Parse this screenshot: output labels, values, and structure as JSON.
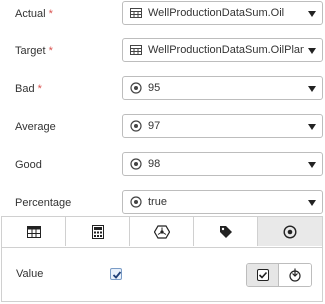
{
  "fields": [
    {
      "label": "Actual",
      "required": true,
      "icon": "table-icon",
      "value": "WellProductionDataSum.Oil"
    },
    {
      "label": "Target",
      "required": true,
      "icon": "table-icon",
      "value": "WellProductionDataSum.OilPlanr"
    },
    {
      "label": "Bad",
      "required": true,
      "icon": "constant-icon",
      "value": "95"
    },
    {
      "label": "Average",
      "required": false,
      "icon": "constant-icon",
      "value": "97"
    },
    {
      "label": "Good",
      "required": false,
      "icon": "constant-icon",
      "value": "98"
    },
    {
      "label": "Percentage",
      "required": false,
      "icon": "constant-icon",
      "value": "true"
    }
  ],
  "required_marker": "*",
  "panel": {
    "tabs": [
      {
        "icon": "table-icon",
        "active": false
      },
      {
        "icon": "calculator-icon",
        "active": false
      },
      {
        "icon": "network-icon",
        "active": false
      },
      {
        "icon": "tag-icon",
        "active": false
      },
      {
        "icon": "constant-icon",
        "active": true
      }
    ],
    "value_label": "Value",
    "checkbox_checked": true,
    "mode_buttons": [
      {
        "icon": "checkbox-mode-icon",
        "active": true
      },
      {
        "icon": "expression-mode-icon",
        "active": false
      }
    ]
  },
  "colors": {
    "required": "#d9534f",
    "active_tab": "#e9e9e9",
    "border": "#bdbdbd"
  }
}
